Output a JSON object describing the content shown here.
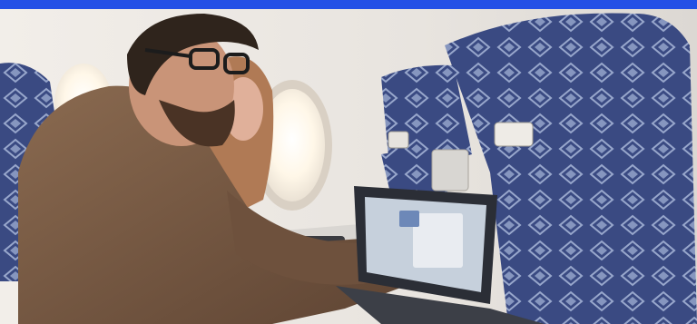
{
  "image": {
    "description_icon": "photo-icon",
    "accent_bar_color": "#2450e6"
  },
  "palette": {
    "cabin_wall": "#ebe7e2",
    "window_glow": "#fffaf0",
    "seat_fabric": "#3c4d84",
    "seat_pattern": "#8fa0c8",
    "jacket": "#7a5a43",
    "hair": "#3a2c22",
    "skin": "#d7a188",
    "laptop_frame": "#2b2e36",
    "screen": "#c9d2dd"
  }
}
